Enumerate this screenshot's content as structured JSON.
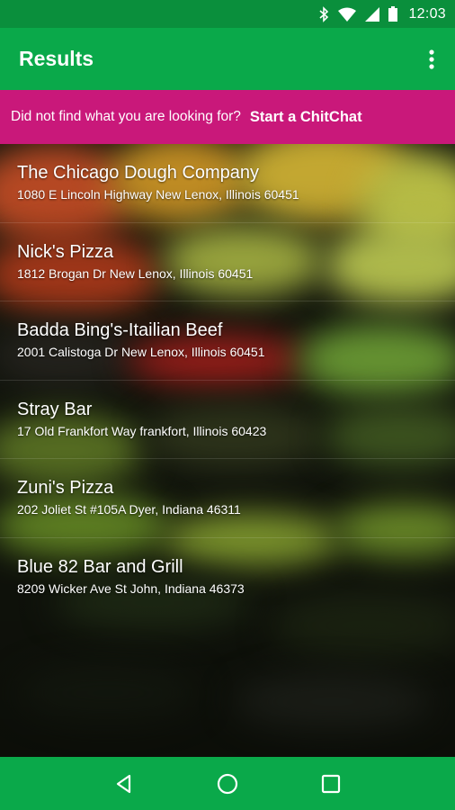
{
  "status_bar": {
    "time": "12:03",
    "icons": [
      "bluetooth-icon",
      "wifi-icon",
      "signal-icon",
      "battery-icon"
    ]
  },
  "app_bar": {
    "title": "Results",
    "menu_icon": "more-vert-icon"
  },
  "banner": {
    "text": "Did not find what you are looking for?",
    "cta": "Start a ChitChat"
  },
  "results": [
    {
      "name": "The Chicago Dough Company",
      "address": "1080 E Lincoln Highway New Lenox, Illinois 60451"
    },
    {
      "name": "Nick's Pizza",
      "address": "1812 Brogan Dr New Lenox, Illinois 60451"
    },
    {
      "name": "Badda Bing's-Itailian Beef",
      "address": "2001 Calistoga Dr New Lenox, Illinois 60451"
    },
    {
      "name": "Stray Bar",
      "address": "17 Old Frankfort Way frankfort, Illinois 60423"
    },
    {
      "name": "Zuni's Pizza",
      "address": "202 Joliet St #105A Dyer, Indiana 46311"
    },
    {
      "name": "Blue 82 Bar and Grill",
      "address": "8209 Wicker Ave St John, Indiana 46373"
    }
  ],
  "nav_bar": {
    "buttons": [
      "back-icon",
      "home-icon",
      "recents-icon"
    ]
  },
  "colors": {
    "status_bar": "#0a8f3c",
    "app_bar": "#0aa94a",
    "banner": "#c9187a",
    "text": "#ffffff"
  }
}
